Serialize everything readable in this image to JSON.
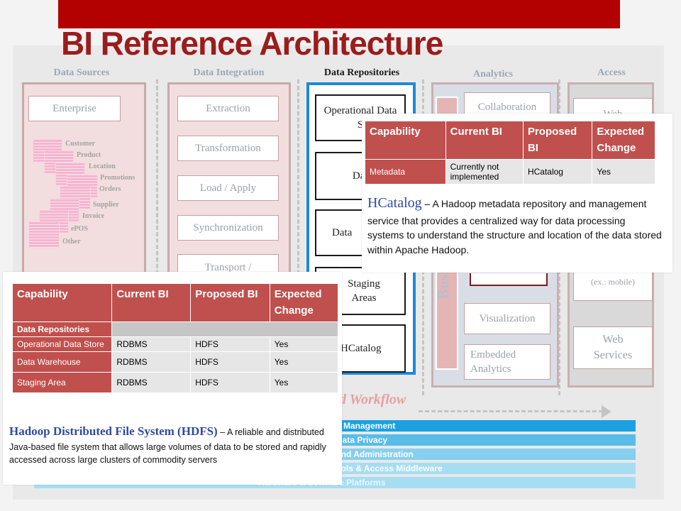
{
  "title": "BI Reference Architecture",
  "columns": {
    "sources": "Data Sources",
    "integration": "Data Integration",
    "repositories": "Data Repositories",
    "analytics": "Analytics",
    "access": "Access"
  },
  "sources": {
    "enterprise": "Enterprise",
    "items": [
      "Customer",
      "Product",
      "Location",
      "Promotions",
      "Orders",
      "Supplier",
      "Invoice",
      "ePOS",
      "Other"
    ]
  },
  "integration": {
    "boxes": [
      "Extraction",
      "Transformation",
      "Load / Apply",
      "Synchronization",
      "Transport /"
    ]
  },
  "repositories": {
    "boxes": [
      "Operational Data S",
      "Da Ware",
      "Data",
      "Staging Areas",
      "HCatalog"
    ]
  },
  "analytics": {
    "vertical_label": "Busi",
    "boxes": [
      "Collaboration",
      "Visualization",
      "Embedded Analytics"
    ]
  },
  "access": {
    "boxes": [
      "Web",
      "(ex.: mobile)",
      "Web Services"
    ]
  },
  "workflow_label": "d Workflow",
  "bands": [
    "a Management",
    "Data Privacy",
    "and Administration",
    "cols & Access Middleware",
    "Hardware & Software Platforms"
  ],
  "colors": {
    "accent_red": "#b30000",
    "title_red": "#9b1c1c",
    "table_red": "#c0504d",
    "repo_blue": "#1e88d8",
    "band_blue_dark": "#1ba1e2",
    "band_blue_light": "#a6ddf3"
  },
  "hcatalog_card": {
    "headers": [
      "Capability",
      "Current BI",
      "Proposed BI",
      "Expected Change"
    ],
    "row": [
      "Metadata",
      "Currently not implemented",
      "HCatalog",
      "Yes"
    ],
    "term": "HCatalog",
    "description": " – A Hadoop metadata repository and management service that provides a centralized way for data processing systems to understand the structure and location of the data stored within Apache Hadoop."
  },
  "hdfs_card": {
    "headers": [
      "Capability",
      "Current BI",
      "Proposed BI",
      "Expected Change"
    ],
    "section": "Data Repositories",
    "rows": [
      [
        "Operational Data Store",
        "RDBMS",
        "HDFS",
        "Yes"
      ],
      [
        "Data Warehouse",
        "RDBMS",
        "HDFS",
        "Yes"
      ],
      [
        "Staging Area",
        "RDBMS",
        "HDFS",
        "Yes"
      ]
    ],
    "term": "Hadoop Distributed File System (HDFS)",
    "description": " – A reliable and distributed Java-based file system that allows large volumes of data to be stored and rapidly accessed across large clusters of commodity servers"
  }
}
